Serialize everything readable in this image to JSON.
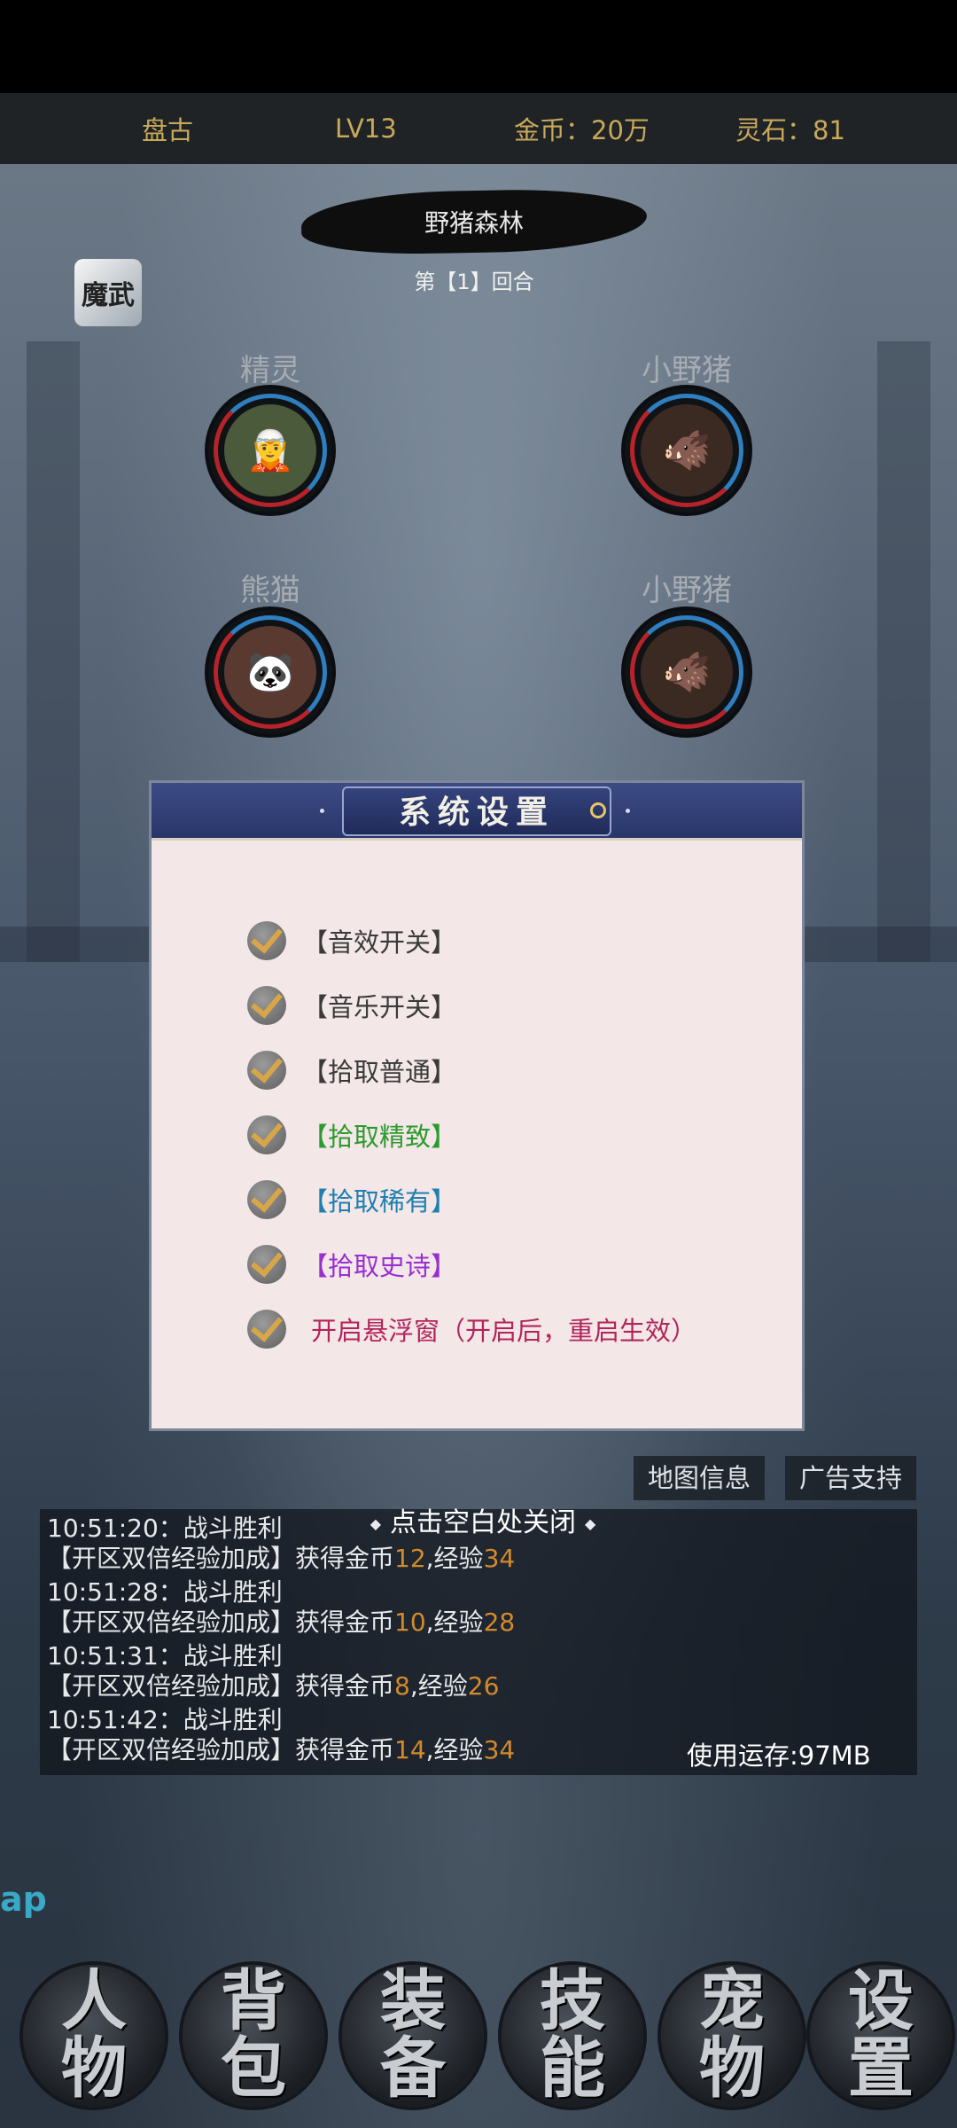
{
  "status": {
    "player_name": "盘古",
    "level": "LV13",
    "gold": "金币：20万",
    "spirit_stone": "灵石：81"
  },
  "battle": {
    "map_name": "野猪森林",
    "round": "第【1】回合",
    "app_icon_text": "魔武",
    "units": [
      {
        "name": "精灵",
        "emoji": "🧝"
      },
      {
        "name": "小野猪",
        "emoji": "🐗"
      },
      {
        "name": "熊猫",
        "emoji": "🐼"
      },
      {
        "name": "小野猪",
        "emoji": "🐗"
      }
    ]
  },
  "settings_dialog": {
    "title": "系统设置",
    "options": [
      {
        "label": "【音效开关】",
        "color": "#3a3a3a",
        "checked": true
      },
      {
        "label": "【音乐开关】",
        "color": "#3a3a3a",
        "checked": true
      },
      {
        "label": "【拾取普通】",
        "color": "#3a3a3a",
        "checked": true
      },
      {
        "label": "【拾取精致】",
        "color": "#2e9a2e",
        "checked": true
      },
      {
        "label": "【拾取稀有】",
        "color": "#1f7fb0",
        "checked": true
      },
      {
        "label": "【拾取史诗】",
        "color": "#9a2fcf",
        "checked": true
      },
      {
        "label": "开启悬浮窗（开启后，重启生效）",
        "color": "#b3245a",
        "checked": true
      }
    ]
  },
  "buttons": {
    "map_info": "地图信息",
    "ad_support": "广告支持"
  },
  "close_hint": "点击空白处关闭",
  "log": {
    "lines": [
      {
        "type": "plain",
        "text": "10:51:20：战斗胜利"
      },
      {
        "type": "reward",
        "prefix": "【开区双倍经验加成】获得金币",
        "gold": "12",
        "mid": ",经验",
        "exp": "34"
      },
      {
        "type": "plain",
        "text": "10:51:28：战斗胜利"
      },
      {
        "type": "reward",
        "prefix": "【开区双倍经验加成】获得金币",
        "gold": "10",
        "mid": ",经验",
        "exp": "28"
      },
      {
        "type": "plain",
        "text": "10:51:31：战斗胜利"
      },
      {
        "type": "reward",
        "prefix": "【开区双倍经验加成】获得金币",
        "gold": "8",
        "mid": ",经验",
        "exp": "26"
      },
      {
        "type": "plain",
        "text": "10:51:42：战斗胜利"
      },
      {
        "type": "reward",
        "prefix": "【开区双倍经验加成】获得金币",
        "gold": "14",
        "mid": ",经验",
        "exp": "34"
      }
    ],
    "memory": "使用运存:97MB"
  },
  "side_text": "ap",
  "bottom_nav": [
    {
      "top": "人",
      "bottom": "物"
    },
    {
      "top": "背",
      "bottom": "包"
    },
    {
      "top": "装",
      "bottom": "备"
    },
    {
      "top": "技",
      "bottom": "能"
    },
    {
      "top": "宠",
      "bottom": "物"
    },
    {
      "top": "设",
      "bottom": "置"
    }
  ]
}
